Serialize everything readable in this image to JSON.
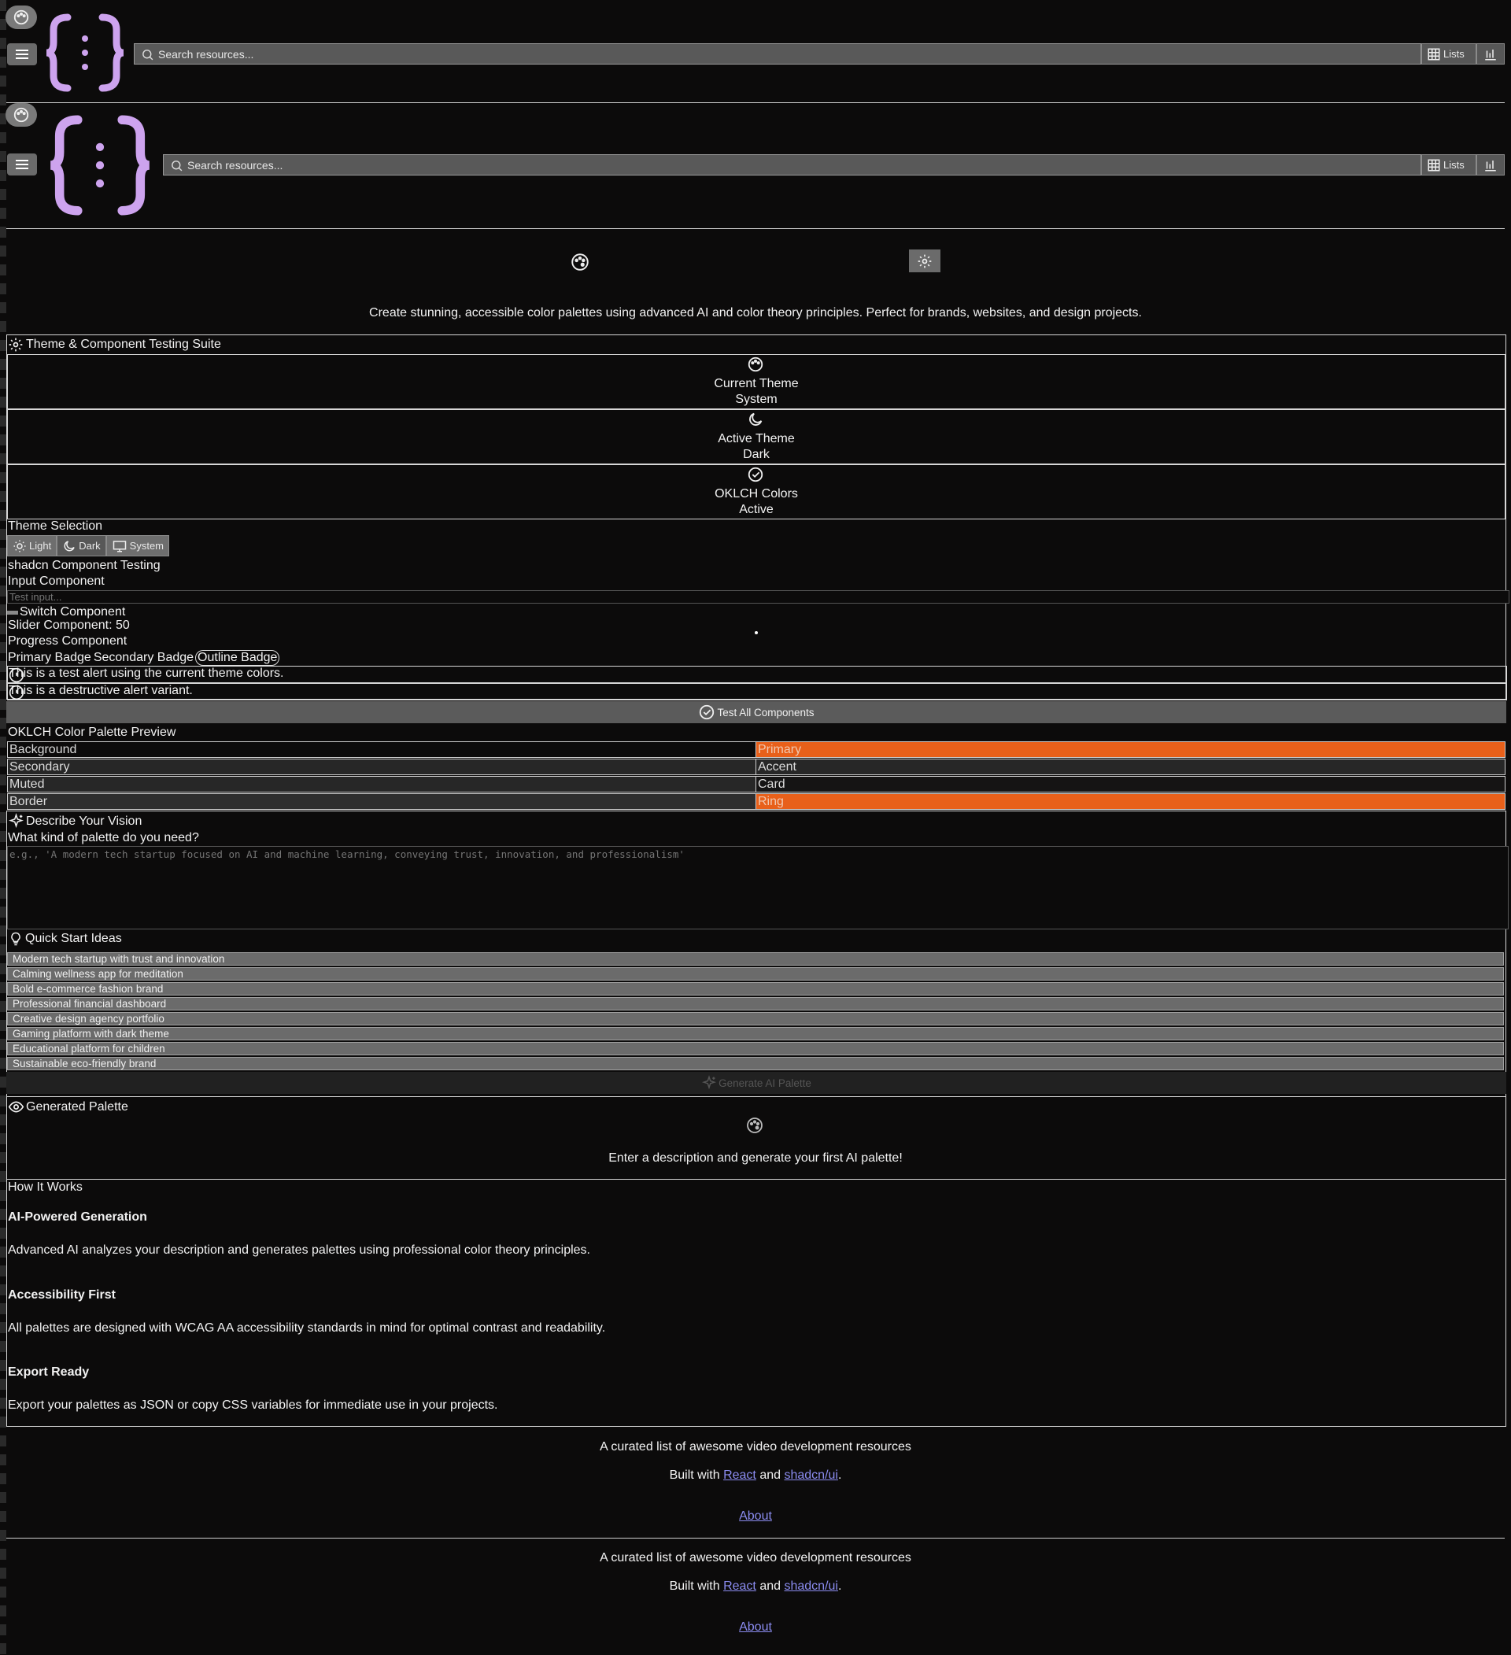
{
  "header": {
    "search_placeholder": "Search resources...",
    "lists_label": "Lists",
    "palette_icon": "palette-icon",
    "menu_icon": "menu-icon",
    "stats_icon": "bar-chart-icon",
    "logo_color": "#cda3ee"
  },
  "hero": {
    "description": "Create stunning, accessible color palettes using advanced AI and color theory principles. Perfect for brands, websites, and design projects."
  },
  "testing_suite": {
    "title": "Theme & Component Testing Suite",
    "cards": [
      {
        "icon": "palette-icon",
        "label": "Current Theme",
        "value": "System"
      },
      {
        "icon": "moon-icon",
        "label": "Active Theme",
        "value": "Dark"
      },
      {
        "icon": "check-circle-icon",
        "label": "OKLCH Colors",
        "value": "Active"
      }
    ],
    "theme_selection_label": "Theme Selection",
    "theme_buttons": [
      "Light",
      "Dark",
      "System"
    ],
    "component_testing_label": "shadcn Component Testing",
    "input_label": "Input Component",
    "input_placeholder": "Test input...",
    "switch_label": "Switch Component",
    "slider_label": "Slider Component: 50",
    "progress_label": "Progress Component",
    "badges": [
      "Primary Badge",
      "Secondary Badge",
      "Outline Badge"
    ],
    "alert_default": "This is a test alert using the current theme colors.",
    "alert_destructive": "This is a destructive alert variant.",
    "test_all_button": "Test All Components"
  },
  "oklch_preview": {
    "title": "OKLCH Color Palette Preview",
    "swatches": [
      {
        "label": "Background",
        "color": "#0c0b0b"
      },
      {
        "label": "Primary",
        "color": "#e8601a"
      },
      {
        "label": "Secondary",
        "color": "#272727"
      },
      {
        "label": "Accent",
        "color": "#272727"
      },
      {
        "label": "Muted",
        "color": "#272727"
      },
      {
        "label": "Card",
        "color": "#151414"
      },
      {
        "label": "Border",
        "color": "#2e2e2e"
      },
      {
        "label": "Ring",
        "color": "#e8601a"
      }
    ]
  },
  "vision": {
    "title": "Describe Your Vision",
    "question": "What kind of palette do you need?",
    "textarea_placeholder": "e.g., 'A modern tech startup focused on AI and machine learning, conveying trust, innovation, and professionalism'",
    "quick_start_title": "Quick Start Ideas",
    "ideas": [
      "Modern tech startup with trust and innovation",
      "Calming wellness app for meditation",
      "Bold e-commerce fashion brand",
      "Professional financial dashboard",
      "Creative design agency portfolio",
      "Gaming platform with dark theme",
      "Educational platform for children",
      "Sustainable eco-friendly brand"
    ],
    "generate_button": "Generate AI Palette"
  },
  "generated": {
    "title": "Generated Palette",
    "empty_text": "Enter a description and generate your first AI palette!"
  },
  "how_it_works": {
    "title": "How It Works",
    "items": [
      {
        "heading": "AI-Powered Generation",
        "text": "Advanced AI analyzes your description and generates palettes using professional color theory principles."
      },
      {
        "heading": "Accessibility First",
        "text": "All palettes are designed with WCAG AA accessibility standards in mind for optimal contrast and readability."
      },
      {
        "heading": "Export Ready",
        "text": "Export your palettes as JSON or copy CSS variables for immediate use in your projects."
      }
    ]
  },
  "footer": {
    "tagline": "A curated list of awesome video development resources",
    "built_with": "Built with",
    "and": "and",
    "period": ".",
    "react_link": "React",
    "shadcn_link": "shadcn/ui",
    "about_link": "About"
  }
}
